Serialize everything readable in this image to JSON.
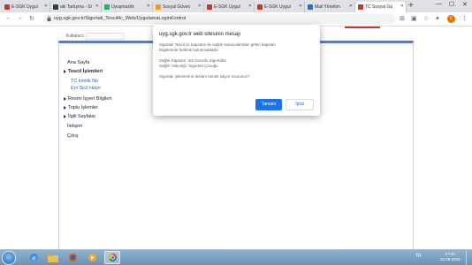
{
  "browser": {
    "tabs": [
      {
        "label": "E-SGK Uygul",
        "favicon_color": "#c0392b"
      },
      {
        "label": "aki Tartışma - Si",
        "favicon_color": "#2c3e50"
      },
      {
        "label": "Uyuşmazlık",
        "favicon_color": "#27ae60"
      },
      {
        "label": "Sosyal Güven",
        "favicon_color": "#f39c12"
      },
      {
        "label": "E-SGK Uygul",
        "favicon_color": "#c0392b"
      },
      {
        "label": "E-SGK Uygul",
        "favicon_color": "#c0392b"
      },
      {
        "label": "Mali Yönetim",
        "favicon_color": "#2f6fb5"
      },
      {
        "label": "TC Sosyal Gü",
        "favicon_color": "#c0392b"
      }
    ],
    "url": "uyg.sgk.gov.tr/Sigortali_Tescil4c_Web/UygulamaLoginKontrol",
    "avatar_letter": "c"
  },
  "page": {
    "user_label": "Kullanıcı:",
    "menu": {
      "home": "Ana Sayfa",
      "tescil": "Tescil İşlemleri",
      "tescil_sub1": "TC kimlik No",
      "tescil_sub2": "Eni Sicil Hayır",
      "resmi": "Resmi İşyeri Bilgileri",
      "toplu": "Toplu İşlemler",
      "ilgili": "İlgili Sayfalar",
      "iletisim": "İletişim",
      "cikis": "Çıkış"
    }
  },
  "dialog": {
    "title": "uyg.sgk.gov.tr web sitesinin mesajı",
    "line1": "Sigortalı Tescil 4c kapsamı ile sağlık sunuculamdan gelen kapsam",
    "line2": "bilgilerinde farklılık bulunmaktadır.",
    "line3": "Sağlık Kapsam :4/a Zorunlu Sigortalar",
    "line4": "Sağlık Yakınlığı :Sigortalı Çocuğu",
    "line5": "Sigortalı işlemlerine devam etmek istiyor musunuz?",
    "ok_label": "Tamam",
    "cancel_label": "İptal"
  },
  "taskbar": {
    "time": "17:04",
    "date": "22.09.2020",
    "lang": "TR"
  }
}
